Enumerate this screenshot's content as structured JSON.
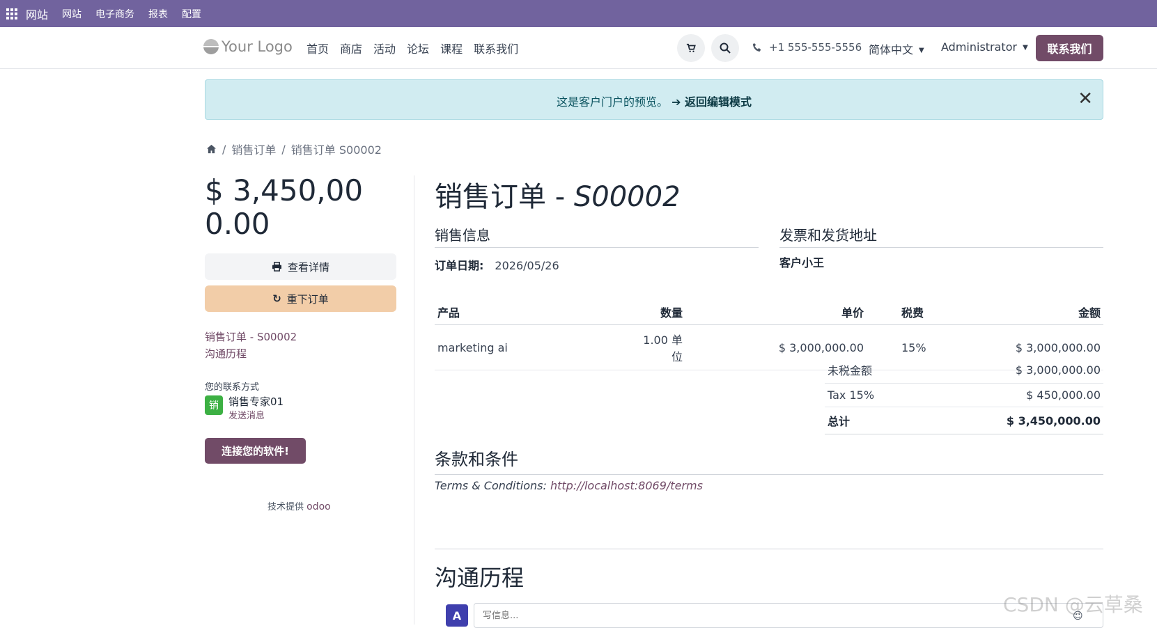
{
  "topbar": {
    "brand": "网站",
    "menus": [
      "网站",
      "电子商务",
      "报表",
      "配置"
    ]
  },
  "navbar": {
    "logo": "Your Logo",
    "links": [
      "首页",
      "商店",
      "活动",
      "论坛",
      "课程",
      "联系我们"
    ],
    "phone": "+1 555-555-5556",
    "language": "简体中文",
    "user": "Administrator",
    "contact_button": "联系我们"
  },
  "alert": {
    "text": "这是客户门户的预览。",
    "link": "➔ 返回编辑模式"
  },
  "breadcrumb": {
    "items": [
      "销售订单",
      "销售订单 S00002"
    ]
  },
  "sidebar": {
    "amount": "$ 3,450,000.00",
    "details_button": "查看详情",
    "reorder_button": "重下订单",
    "link_order": "销售订单 - S00002",
    "link_history": "沟通历程",
    "contact_label": "您的联系方式",
    "contact_avatar": "销",
    "contact_name": "销售专家01",
    "contact_message": "发送消息",
    "connect_button": "连接您的软件!",
    "powered_by": "技术提供",
    "powered_brand": "odoo"
  },
  "order": {
    "title_prefix": "销售订单 - ",
    "title_number": "S00002",
    "sales_info_heading": "销售信息",
    "address_heading": "发票和发货地址",
    "date_label": "订单日期:",
    "date_value": "2026/05/26",
    "customer": "客户小王",
    "columns": {
      "product": "产品",
      "qty": "数量",
      "price": "单价",
      "tax": "税费",
      "amount": "金额"
    },
    "lines": [
      {
        "product": "marketing ai",
        "qty": "1.00 单位",
        "price": "$ 3,000,000.00",
        "tax": "15%",
        "amount": "$ 3,000,000.00"
      }
    ],
    "totals": {
      "untaxed_label": "未税金额",
      "untaxed_value": "$ 3,000,000.00",
      "tax_label": "Tax 15%",
      "tax_value": "$ 450,000.00",
      "total_label": "总计",
      "total_value": "$ 3,450,000.00"
    },
    "terms_heading": "条款和条件",
    "terms_label": "Terms & Conditions: ",
    "terms_link": "http://localhost:8069/terms",
    "history_heading": "沟通历程",
    "message_avatar": "A",
    "message_placeholder": "写信息..."
  },
  "watermark": "CSDN @云草桑",
  "colors": {
    "topbar": "#71639e",
    "primary": "#714b67",
    "reorder": "#f2cda8",
    "alert": "#d1ecf1"
  }
}
